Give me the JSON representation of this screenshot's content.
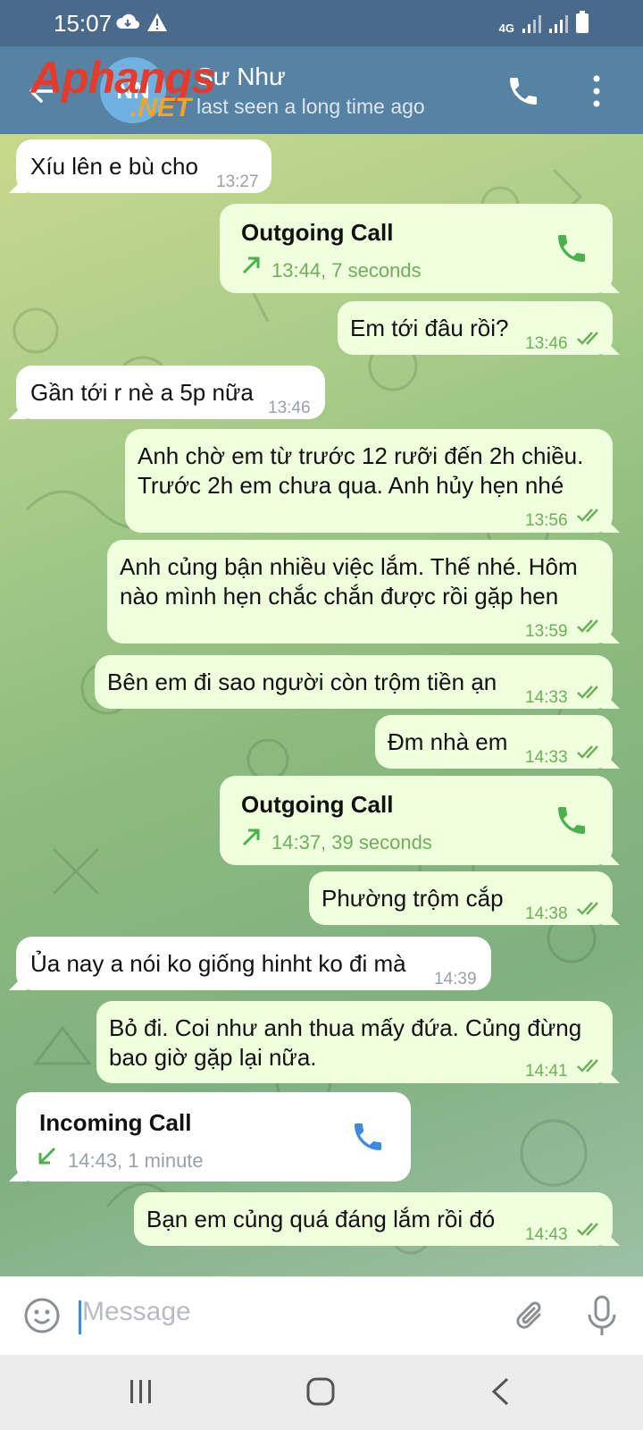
{
  "status_bar": {
    "time": "15:07",
    "network": "4G"
  },
  "header": {
    "avatar_initials": "NN",
    "contact_name": "Sư Như",
    "contact_status": "last seen a long time ago",
    "watermark_main": "Aphangs",
    "watermark_net": ".NET"
  },
  "messages": [
    {
      "text": "Xíu lên e bù cho",
      "time": "13:27"
    },
    {
      "title": "Outgoing Call",
      "detail": "13:44, 7 seconds"
    },
    {
      "text": "Em tới đâu rồi?",
      "time": "13:46"
    },
    {
      "text": "Gần tới r nè a 5p nữa",
      "time": "13:46"
    },
    {
      "line1": "Anh chờ em từ trước 12 rưỡi đến 2h chiều.",
      "line2": "Trước 2h em chưa qua. Anh hủy hẹn nhé",
      "time": "13:56"
    },
    {
      "line1": "Anh củng bận nhiều việc lắm. Thế nhé. Hôm",
      "line2": "nào mình hẹn chắc chắn được rồi gặp hen",
      "time": "13:59"
    },
    {
      "text": "Bên em đi sao người còn trộm tiền ạn",
      "time": "14:33"
    },
    {
      "text": "Đm nhà em",
      "time": "14:33"
    },
    {
      "title": "Outgoing Call",
      "detail": "14:37, 39 seconds"
    },
    {
      "text": "Phường trộm cắp",
      "time": "14:38"
    },
    {
      "text": "Ủa nay a nói ko giống hinht ko đi mà",
      "time": "14:39"
    },
    {
      "line1": "Bỏ đi. Coi như anh thua mấy đứa. Củng đừng",
      "line2": "bao giờ gặp lại nữa.",
      "time": "14:41"
    },
    {
      "title": "Incoming Call",
      "detail": "14:43, 1 minute"
    },
    {
      "text": "Bạn em củng quá đáng lắm rồi đó",
      "time": "14:43"
    }
  ],
  "composer": {
    "placeholder": "Message"
  },
  "colors": {
    "header": "#5682a3",
    "status_bar": "#4a6a8c",
    "outgoing_bubble": "#effedd",
    "incoming_bubble": "#ffffff",
    "accent_green": "#6fae5a",
    "call_icon_blue": "#3d8ae0"
  },
  "icons": [
    "back-arrow-icon",
    "phone-icon",
    "more-vertical-icon",
    "emoji-icon",
    "paperclip-icon",
    "microphone-icon",
    "double-check-icon",
    "call-outgoing-arrow-icon",
    "call-incoming-arrow-icon"
  ]
}
